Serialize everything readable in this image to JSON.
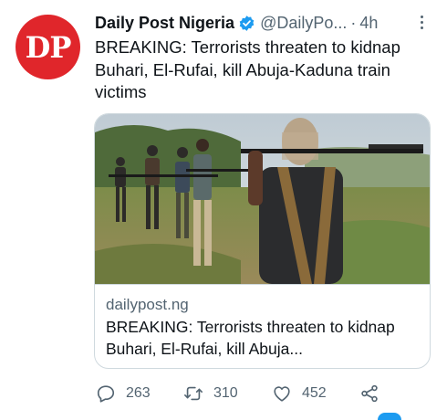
{
  "tweet": {
    "avatar_text": "DP",
    "display_name": "Daily Post Nigeria",
    "handle": "@DailyPo...",
    "separator": "·",
    "time": "4h",
    "text": "BREAKING: Terrorists threaten to kidnap Buhari, El-Rufai, kill Abuja-Kaduna train victims"
  },
  "card": {
    "domain": "dailypost.ng",
    "title": "BREAKING: Terrorists threaten to kidnap Buhari, El-Rufai, kill Abuja..."
  },
  "actions": {
    "replies": "263",
    "retweets": "310",
    "likes": "452"
  },
  "colors": {
    "brand_red": "#e0262b",
    "verified_blue": "#1d9bf0",
    "secondary_text": "#536471"
  },
  "icons": [
    "verified-badge-icon",
    "more-icon",
    "reply-icon",
    "retweet-icon",
    "like-icon",
    "share-icon"
  ]
}
